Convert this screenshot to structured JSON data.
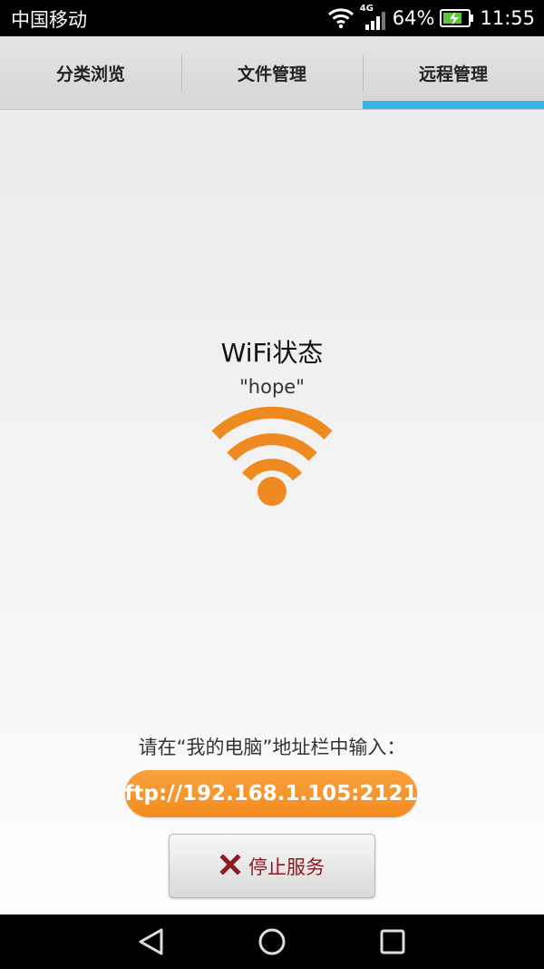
{
  "status_bar": {
    "carrier": "中国移动",
    "network": "4G",
    "battery": "64%",
    "time": "11:55"
  },
  "tabs": [
    {
      "label": "分类浏览",
      "active": false
    },
    {
      "label": "文件管理",
      "active": false
    },
    {
      "label": "远程管理",
      "active": true
    }
  ],
  "main": {
    "wifi_title": "WiFi状态",
    "ssid": "\"hope\"",
    "instruction": "请在“我的电脑”地址栏中输入：",
    "ftp_address": "ftp://192.168.1.105:2121",
    "stop_label": "停止服务"
  },
  "colors": {
    "accent": "#35b6e6",
    "orange": "#f38b1f",
    "stop_red": "#8b1b1f"
  },
  "icons": {
    "wifi_big": "wifi-icon",
    "stop": "close-icon",
    "nav_back": "back-icon",
    "nav_home": "home-icon",
    "nav_recent": "recent-apps-icon"
  }
}
